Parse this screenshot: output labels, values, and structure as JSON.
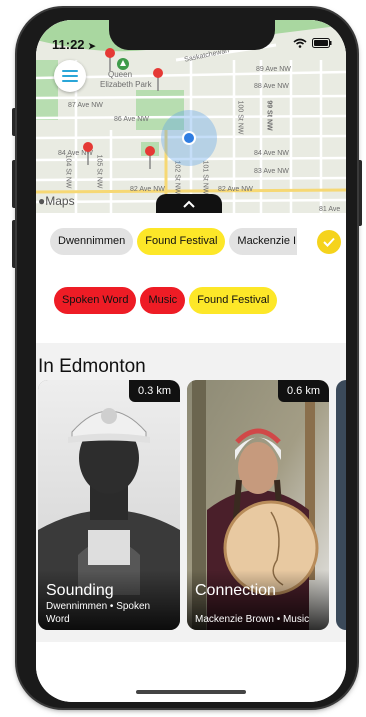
{
  "status_bar": {
    "time": "11:22"
  },
  "map": {
    "labels": [
      "Saskatchewan",
      "Queen",
      "Elizabeth Park",
      "89 Ave NW",
      "88 Ave NW",
      "87 Ave NW",
      "86 Ave NW",
      "84 Ave NW",
      "84 Ave NW",
      "83 Ave NW",
      "82 Ave NW",
      "82 Ave NW",
      "81 Ave",
      "99 St NW",
      "100 St NW",
      "104 St NW",
      "105 St NW",
      "102 St NW",
      "101 St NW"
    ],
    "attribution": "Maps"
  },
  "filters": {
    "row1": [
      {
        "label": "Dwennimmen",
        "style": "gray"
      },
      {
        "label": "Found Festival",
        "style": "yellow"
      },
      {
        "label": "Mackenzie I",
        "style": "gray"
      }
    ],
    "row2": [
      {
        "label": "Spoken Word",
        "style": "red"
      },
      {
        "label": "Music",
        "style": "red"
      },
      {
        "label": "Found Festival",
        "style": "yellow"
      }
    ]
  },
  "section": {
    "title": "In Edmonton"
  },
  "cards": [
    {
      "distance": "0.3 km",
      "title": "Sounding",
      "subtitle": "Dwennimmen • Spoken Word"
    },
    {
      "distance": "0.6 km",
      "title": "Connection",
      "subtitle": "Mackenzie Brown • Music"
    }
  ],
  "colors": {
    "chip_yellow": "#fde728",
    "chip_red": "#ee1c25",
    "chip_gray": "#e2e2e2",
    "location_blue": "#2f7de1",
    "pin_red": "#e53935"
  },
  "icons": [
    "menu-icon",
    "location-arrow-icon",
    "wifi-icon",
    "battery-icon",
    "map-pin-icon",
    "chevron-up-icon",
    "checkmark-icon",
    "apple-logo-icon"
  ]
}
